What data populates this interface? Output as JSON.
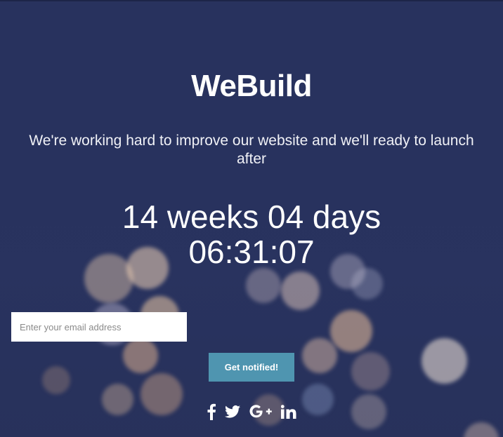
{
  "brand": "WeBuild",
  "tagline": "We're working hard to improve our website and we'll ready to launch after",
  "countdown": {
    "line1": "14 weeks 04 days",
    "line2": "06:31:07"
  },
  "signup": {
    "email_placeholder": "Enter your email address",
    "button_label": "Get notified!"
  },
  "social": [
    {
      "name": "facebook-icon",
      "glyph": "f"
    },
    {
      "name": "twitter-icon",
      "glyph": "twitter"
    },
    {
      "name": "google-plus-icon",
      "glyph": "G+"
    },
    {
      "name": "linkedin-icon",
      "glyph": "in"
    }
  ],
  "colors": {
    "background": "#2a3460",
    "button": "#4f95b0",
    "text": "#ffffff"
  }
}
